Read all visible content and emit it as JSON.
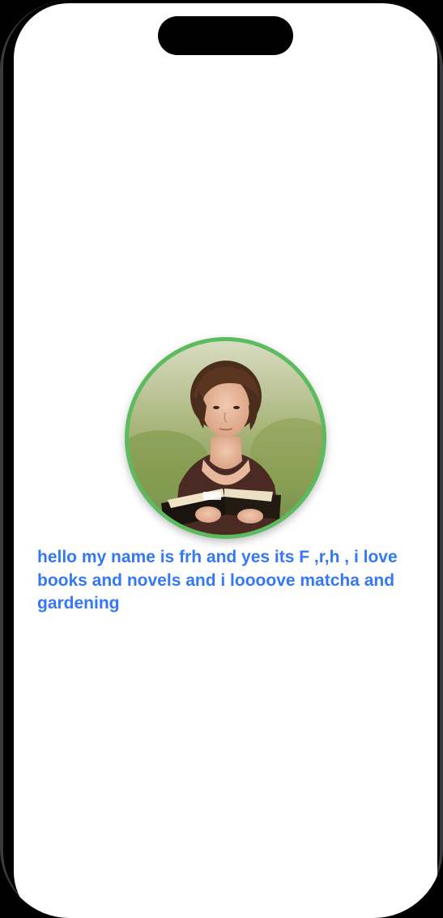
{
  "colors": {
    "accent_text": "#3478f6",
    "avatar_ring": "#5bbb5e",
    "screen_background": "#ffffff",
    "device_frame": "#000000"
  },
  "device": {
    "notch": "dynamic-island"
  },
  "profile": {
    "avatar_icon": "profile-photo",
    "bio": "hello my name is frh and yes its F ,r,h , i love books and novels and i loooove matcha and gardening"
  }
}
